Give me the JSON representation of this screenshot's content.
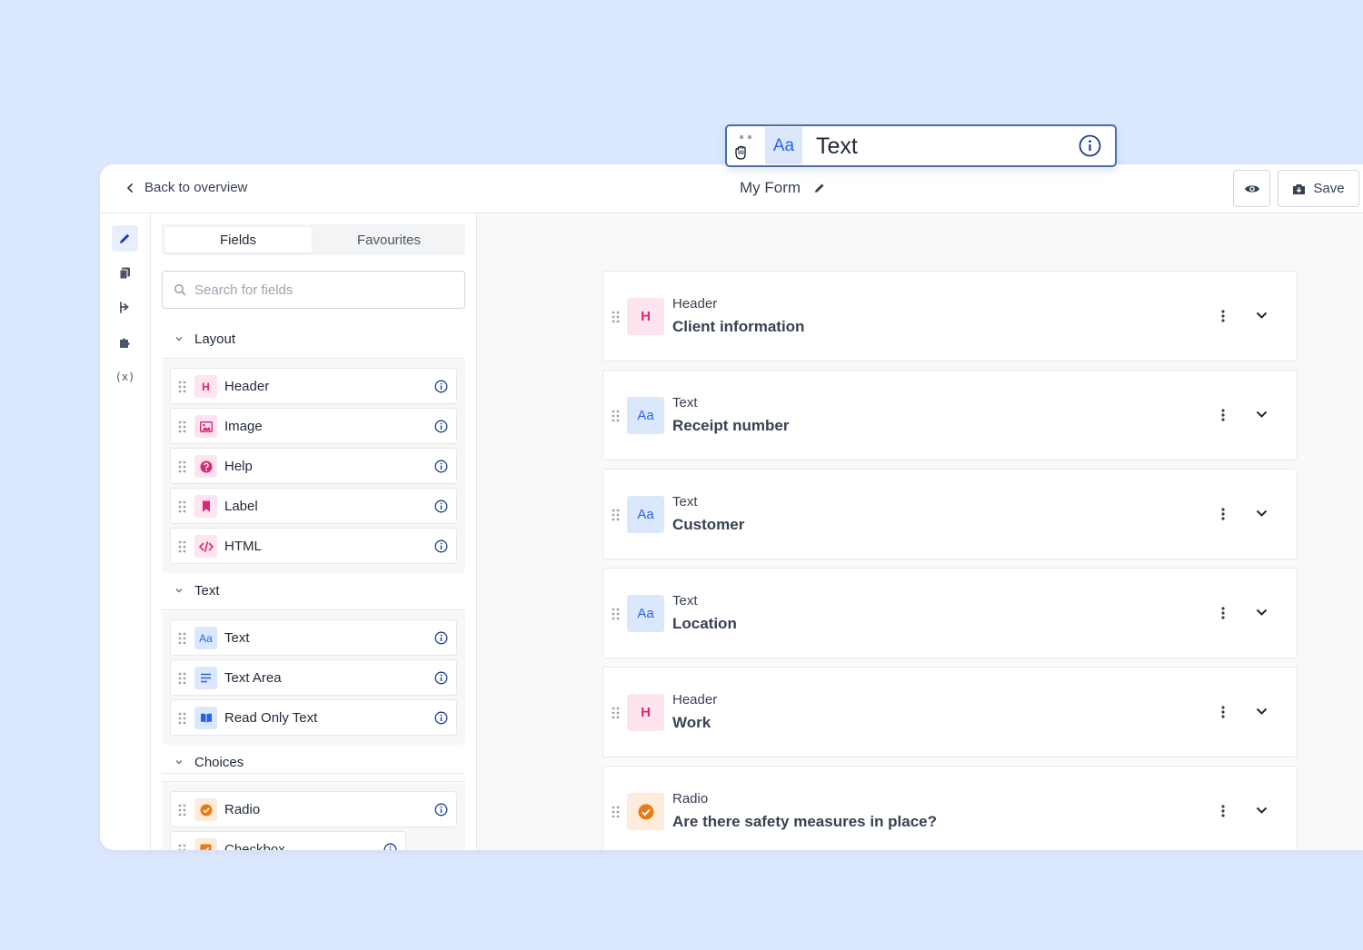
{
  "header": {
    "back_label": "Back to overview",
    "form_title": "My Form",
    "save_label": "Save"
  },
  "rail": {
    "items": [
      "edit-icon",
      "copy-icon",
      "flow-icon",
      "puzzle-icon",
      "variable-icon"
    ],
    "variable_text": "(x)"
  },
  "sidebar": {
    "tabs": [
      "Fields",
      "Favourites"
    ],
    "active_tab": "Fields",
    "search_placeholder": "Search for fields",
    "sections": [
      {
        "title": "Layout",
        "fields": [
          {
            "label": "Header",
            "icon": "header-icon",
            "icon_text": "H"
          },
          {
            "label": "Image",
            "icon": "image-icon"
          },
          {
            "label": "Help",
            "icon": "help-icon"
          },
          {
            "label": "Label",
            "icon": "bookmark-icon"
          },
          {
            "label": "HTML",
            "icon": "code-icon"
          }
        ]
      },
      {
        "title": "Text",
        "fields": [
          {
            "label": "Text",
            "icon": "text-icon",
            "icon_text": "Aa"
          },
          {
            "label": "Text Area",
            "icon": "text-area-icon"
          },
          {
            "label": "Read Only Text",
            "icon": "book-icon"
          }
        ]
      },
      {
        "title": "Choices",
        "fields": [
          {
            "label": "Radio",
            "icon": "radio-icon"
          },
          {
            "label": "Checkbox",
            "icon": "checkbox-icon"
          }
        ]
      }
    ]
  },
  "canvas": {
    "cards": [
      {
        "type": "Header",
        "label": "Client information",
        "icon_text": "H"
      },
      {
        "type": "Text",
        "label": "Receipt number",
        "icon_text": "Aa"
      },
      {
        "type": "Text",
        "label": "Customer",
        "icon_text": "Aa"
      },
      {
        "type": "Text",
        "label": "Location",
        "icon_text": "Aa"
      },
      {
        "type": "Header",
        "label": "Work",
        "icon_text": "H"
      },
      {
        "type": "Radio",
        "label": "Are there safety measures in place?"
      }
    ],
    "drag_ghost": {
      "icon_text": "Aa",
      "label": "Text"
    }
  },
  "colors": {
    "page_bg": "#dce8fd",
    "header_accent": "#db2777",
    "text_accent": "#2563eb",
    "radio_accent": "#ea7a13",
    "drop_indicator": "#3b82f6"
  }
}
